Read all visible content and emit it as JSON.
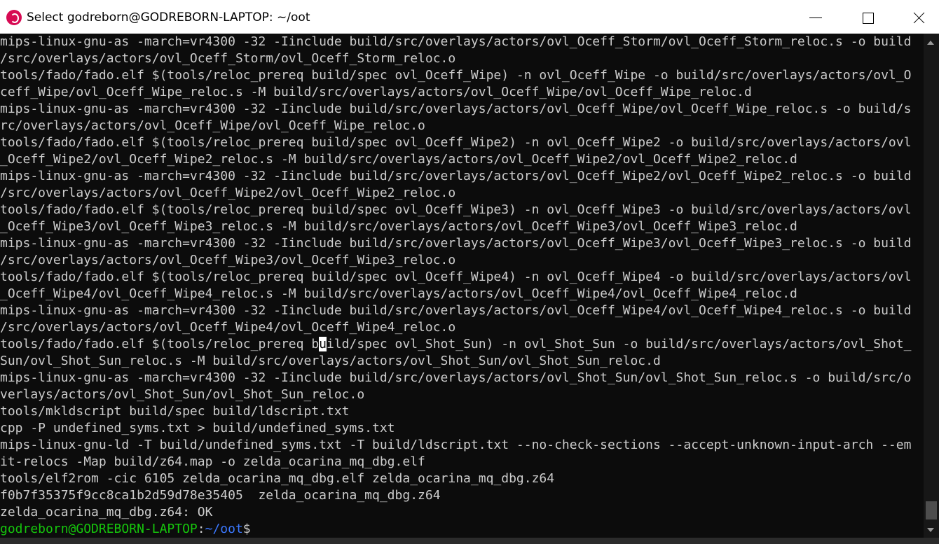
{
  "window": {
    "title": "Select godreborn@GODREBORN-LAPTOP: ~/oot",
    "app_icon": "debian-swirl-icon",
    "accent_color": "#d70a53"
  },
  "terminal": {
    "lines": [
      "mips-linux-gnu-as -march=vr4300 -32 -Iinclude build/src/overlays/actors/ovl_Oceff_Storm/ovl_Oceff_Storm_reloc.s -o build",
      "/src/overlays/actors/ovl_Oceff_Storm/ovl_Oceff_Storm_reloc.o",
      "tools/fado/fado.elf $(tools/reloc_prereq build/spec ovl_Oceff_Wipe) -n ovl_Oceff_Wipe -o build/src/overlays/actors/ovl_O",
      "ceff_Wipe/ovl_Oceff_Wipe_reloc.s -M build/src/overlays/actors/ovl_Oceff_Wipe/ovl_Oceff_Wipe_reloc.d",
      "mips-linux-gnu-as -march=vr4300 -32 -Iinclude build/src/overlays/actors/ovl_Oceff_Wipe/ovl_Oceff_Wipe_reloc.s -o build/s",
      "rc/overlays/actors/ovl_Oceff_Wipe/ovl_Oceff_Wipe_reloc.o",
      "tools/fado/fado.elf $(tools/reloc_prereq build/spec ovl_Oceff_Wipe2) -n ovl_Oceff_Wipe2 -o build/src/overlays/actors/ovl",
      "_Oceff_Wipe2/ovl_Oceff_Wipe2_reloc.s -M build/src/overlays/actors/ovl_Oceff_Wipe2/ovl_Oceff_Wipe2_reloc.d",
      "mips-linux-gnu-as -march=vr4300 -32 -Iinclude build/src/overlays/actors/ovl_Oceff_Wipe2/ovl_Oceff_Wipe2_reloc.s -o build",
      "/src/overlays/actors/ovl_Oceff_Wipe2/ovl_Oceff_Wipe2_reloc.o",
      "tools/fado/fado.elf $(tools/reloc_prereq build/spec ovl_Oceff_Wipe3) -n ovl_Oceff_Wipe3 -o build/src/overlays/actors/ovl",
      "_Oceff_Wipe3/ovl_Oceff_Wipe3_reloc.s -M build/src/overlays/actors/ovl_Oceff_Wipe3/ovl_Oceff_Wipe3_reloc.d",
      "mips-linux-gnu-as -march=vr4300 -32 -Iinclude build/src/overlays/actors/ovl_Oceff_Wipe3/ovl_Oceff_Wipe3_reloc.s -o build",
      "/src/overlays/actors/ovl_Oceff_Wipe3/ovl_Oceff_Wipe3_reloc.o",
      "tools/fado/fado.elf $(tools/reloc_prereq build/spec ovl_Oceff_Wipe4) -n ovl_Oceff_Wipe4 -o build/src/overlays/actors/ovl",
      "_Oceff_Wipe4/ovl_Oceff_Wipe4_reloc.s -M build/src/overlays/actors/ovl_Oceff_Wipe4/ovl_Oceff_Wipe4_reloc.d",
      "mips-linux-gnu-as -march=vr4300 -32 -Iinclude build/src/overlays/actors/ovl_Oceff_Wipe4/ovl_Oceff_Wipe4_reloc.s -o build",
      "/src/overlays/actors/ovl_Oceff_Wipe4/ovl_Oceff_Wipe4_reloc.o"
    ],
    "cursor_line": {
      "before": "tools/fado/fado.elf $(tools/reloc_prereq b",
      "cursor_char": "u",
      "after": "ild/spec ovl_Shot_Sun) -n ovl_Shot_Sun -o build/src/overlays/actors/ovl_Shot_"
    },
    "lines_after": [
      "Sun/ovl_Shot_Sun_reloc.s -M build/src/overlays/actors/ovl_Shot_Sun/ovl_Shot_Sun_reloc.d",
      "mips-linux-gnu-as -march=vr4300 -32 -Iinclude build/src/overlays/actors/ovl_Shot_Sun/ovl_Shot_Sun_reloc.s -o build/src/o",
      "verlays/actors/ovl_Shot_Sun/ovl_Shot_Sun_reloc.o",
      "tools/mkldscript build/spec build/ldscript.txt",
      "cpp -P undefined_syms.txt > build/undefined_syms.txt",
      "mips-linux-gnu-ld -T build/undefined_syms.txt -T build/ldscript.txt --no-check-sections --accept-unknown-input-arch --em",
      "it-relocs -Map build/z64.map -o zelda_ocarina_mq_dbg.elf",
      "tools/elf2rom -cic 6105 zelda_ocarina_mq_dbg.elf zelda_ocarina_mq_dbg.z64",
      "f0b7f35375f9cc8ca1b2d59d78e35405  zelda_ocarina_mq_dbg.z64",
      "zelda_ocarina_mq_dbg.z64: OK"
    ],
    "prompt": {
      "user_host": "godreborn@GODREBORN-LAPTOP",
      "separator": ":",
      "path": "~/oot",
      "symbol": "$"
    },
    "colors": {
      "background": "#0c0c0c",
      "foreground": "#cccccc",
      "prompt_user": "#16c60c",
      "prompt_path": "#3b78ff"
    }
  },
  "scrollbar": {
    "icons": [
      "scroll-up-arrow-icon",
      "scroll-down-arrow-icon"
    ],
    "position_fraction": 0.97
  }
}
